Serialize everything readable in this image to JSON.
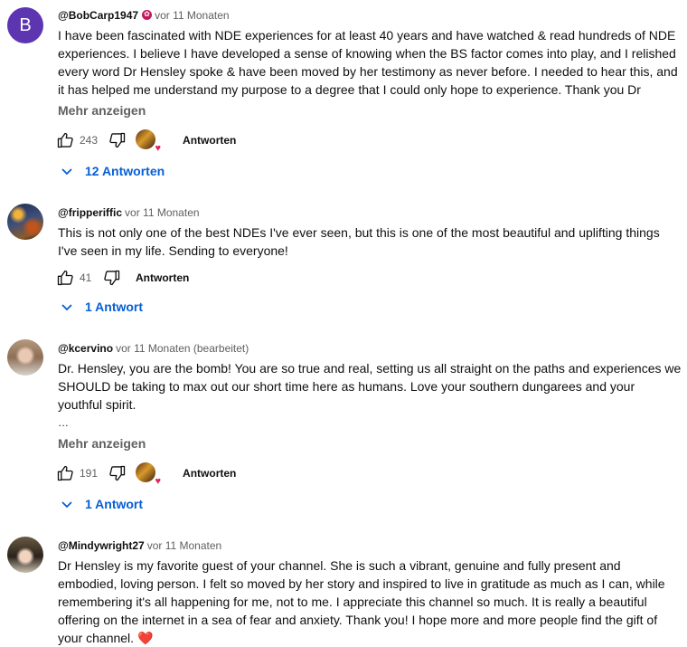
{
  "comments": [
    {
      "author": "@BobCarp1947",
      "time": "vor 11 Monaten",
      "avatar_letter": "B",
      "text": "I have been fascinated with NDE experiences for at least 40 years and have watched & read hundreds of NDE experiences.  I believe I have developed a sense of knowing when the BS factor comes into play, and I relished every word Dr Hensley spoke & have been moved by her testimony as never before.  I needed to hear this, and it has helped me understand my purpose to a degree that I could only hope to experience.  Thank you Dr Hensley,…",
      "show_more": "Mehr anzeigen",
      "likes": "243",
      "reply_label": "Antworten",
      "replies_label": "12 Antworten"
    },
    {
      "author": "@fripperiffic",
      "time": "vor 11 Monaten",
      "text": "This is not only one of the best NDEs I've ever seen, but this is one of the most beautiful and uplifting things I've seen in my life. Sending to everyone!",
      "likes": "41",
      "reply_label": "Antworten",
      "replies_label": "1 Antwort"
    },
    {
      "author": "@kcervino",
      "time": "vor 11 Monaten (bearbeitet)",
      "text": "Dr. Hensley, you are the bomb!  You are so true and real, setting us all straight on the paths and experiences we SHOULD be taking to max out our short time here as humans.  Love your southern dungarees and your youthful spirit.",
      "ellipsis": "…",
      "show_more": "Mehr anzeigen",
      "likes": "191",
      "reply_label": "Antworten",
      "replies_label": "1 Antwort"
    },
    {
      "author": "@Mindywright27",
      "time": "vor 11 Monaten",
      "text": "Dr Hensley is my favorite guest of your channel. She is such a vibrant, genuine and fully present and embodied, loving person. I felt so moved by her story and inspired to live in gratitude as much as I can, while remembering it's all happening for me, not to me. I appreciate this channel so much. It is really a beautiful offering on the internet in a sea of fear and anxiety. Thank you! I hope more and more people find the gift of your channel. ❤️"
    }
  ],
  "colors": {
    "link_blue": "#065fd4",
    "meta_gray": "#606060",
    "heart_red": "#e0245e",
    "avatar_purple": "#5e35b1"
  }
}
